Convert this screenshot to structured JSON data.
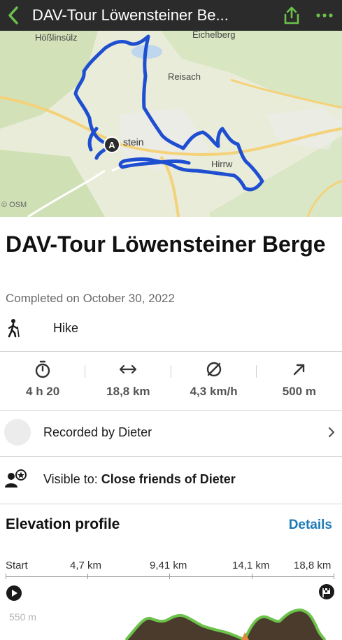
{
  "header": {
    "title": "DAV-Tour Löwensteiner Be...",
    "back_icon": "chevron-left-icon",
    "share_icon": "share-icon",
    "more_icon": "more-dots-icon",
    "accent": "#6cc24a"
  },
  "map": {
    "labels": {
      "hosslinsulz": "Hößlinsülz",
      "eichelberg": "Eichelberg",
      "reisach": "Reisach",
      "lowenstein": "stein",
      "hirrweiler": "Hirrw",
      "osm": "© OSM"
    },
    "start_marker": "A",
    "route_color": "#1f4fd1"
  },
  "tour": {
    "title": "DAV-Tour Löwensteiner Berge",
    "completed": "Completed on October 30, 2022",
    "activity": "Hike"
  },
  "stats": [
    {
      "icon": "stopwatch-icon",
      "value": "4 h 20"
    },
    {
      "icon": "distance-arrows-icon",
      "value": "18,8 km"
    },
    {
      "icon": "average-speed-icon",
      "value": "4,3 km/h"
    },
    {
      "icon": "uphill-arrow-icon",
      "value": "500 m"
    }
  ],
  "recorded": {
    "prefix": "Recorded by",
    "name": "Dieter"
  },
  "visibility": {
    "prefix": "Visible to:",
    "value": "Close friends of Dieter"
  },
  "elevation": {
    "title": "Elevation profile",
    "details_label": "Details",
    "axis": [
      "Start",
      "4,7 km",
      "9,41 km",
      "14,1 km",
      "18,8 km"
    ],
    "altitude_label": "550 m"
  }
}
